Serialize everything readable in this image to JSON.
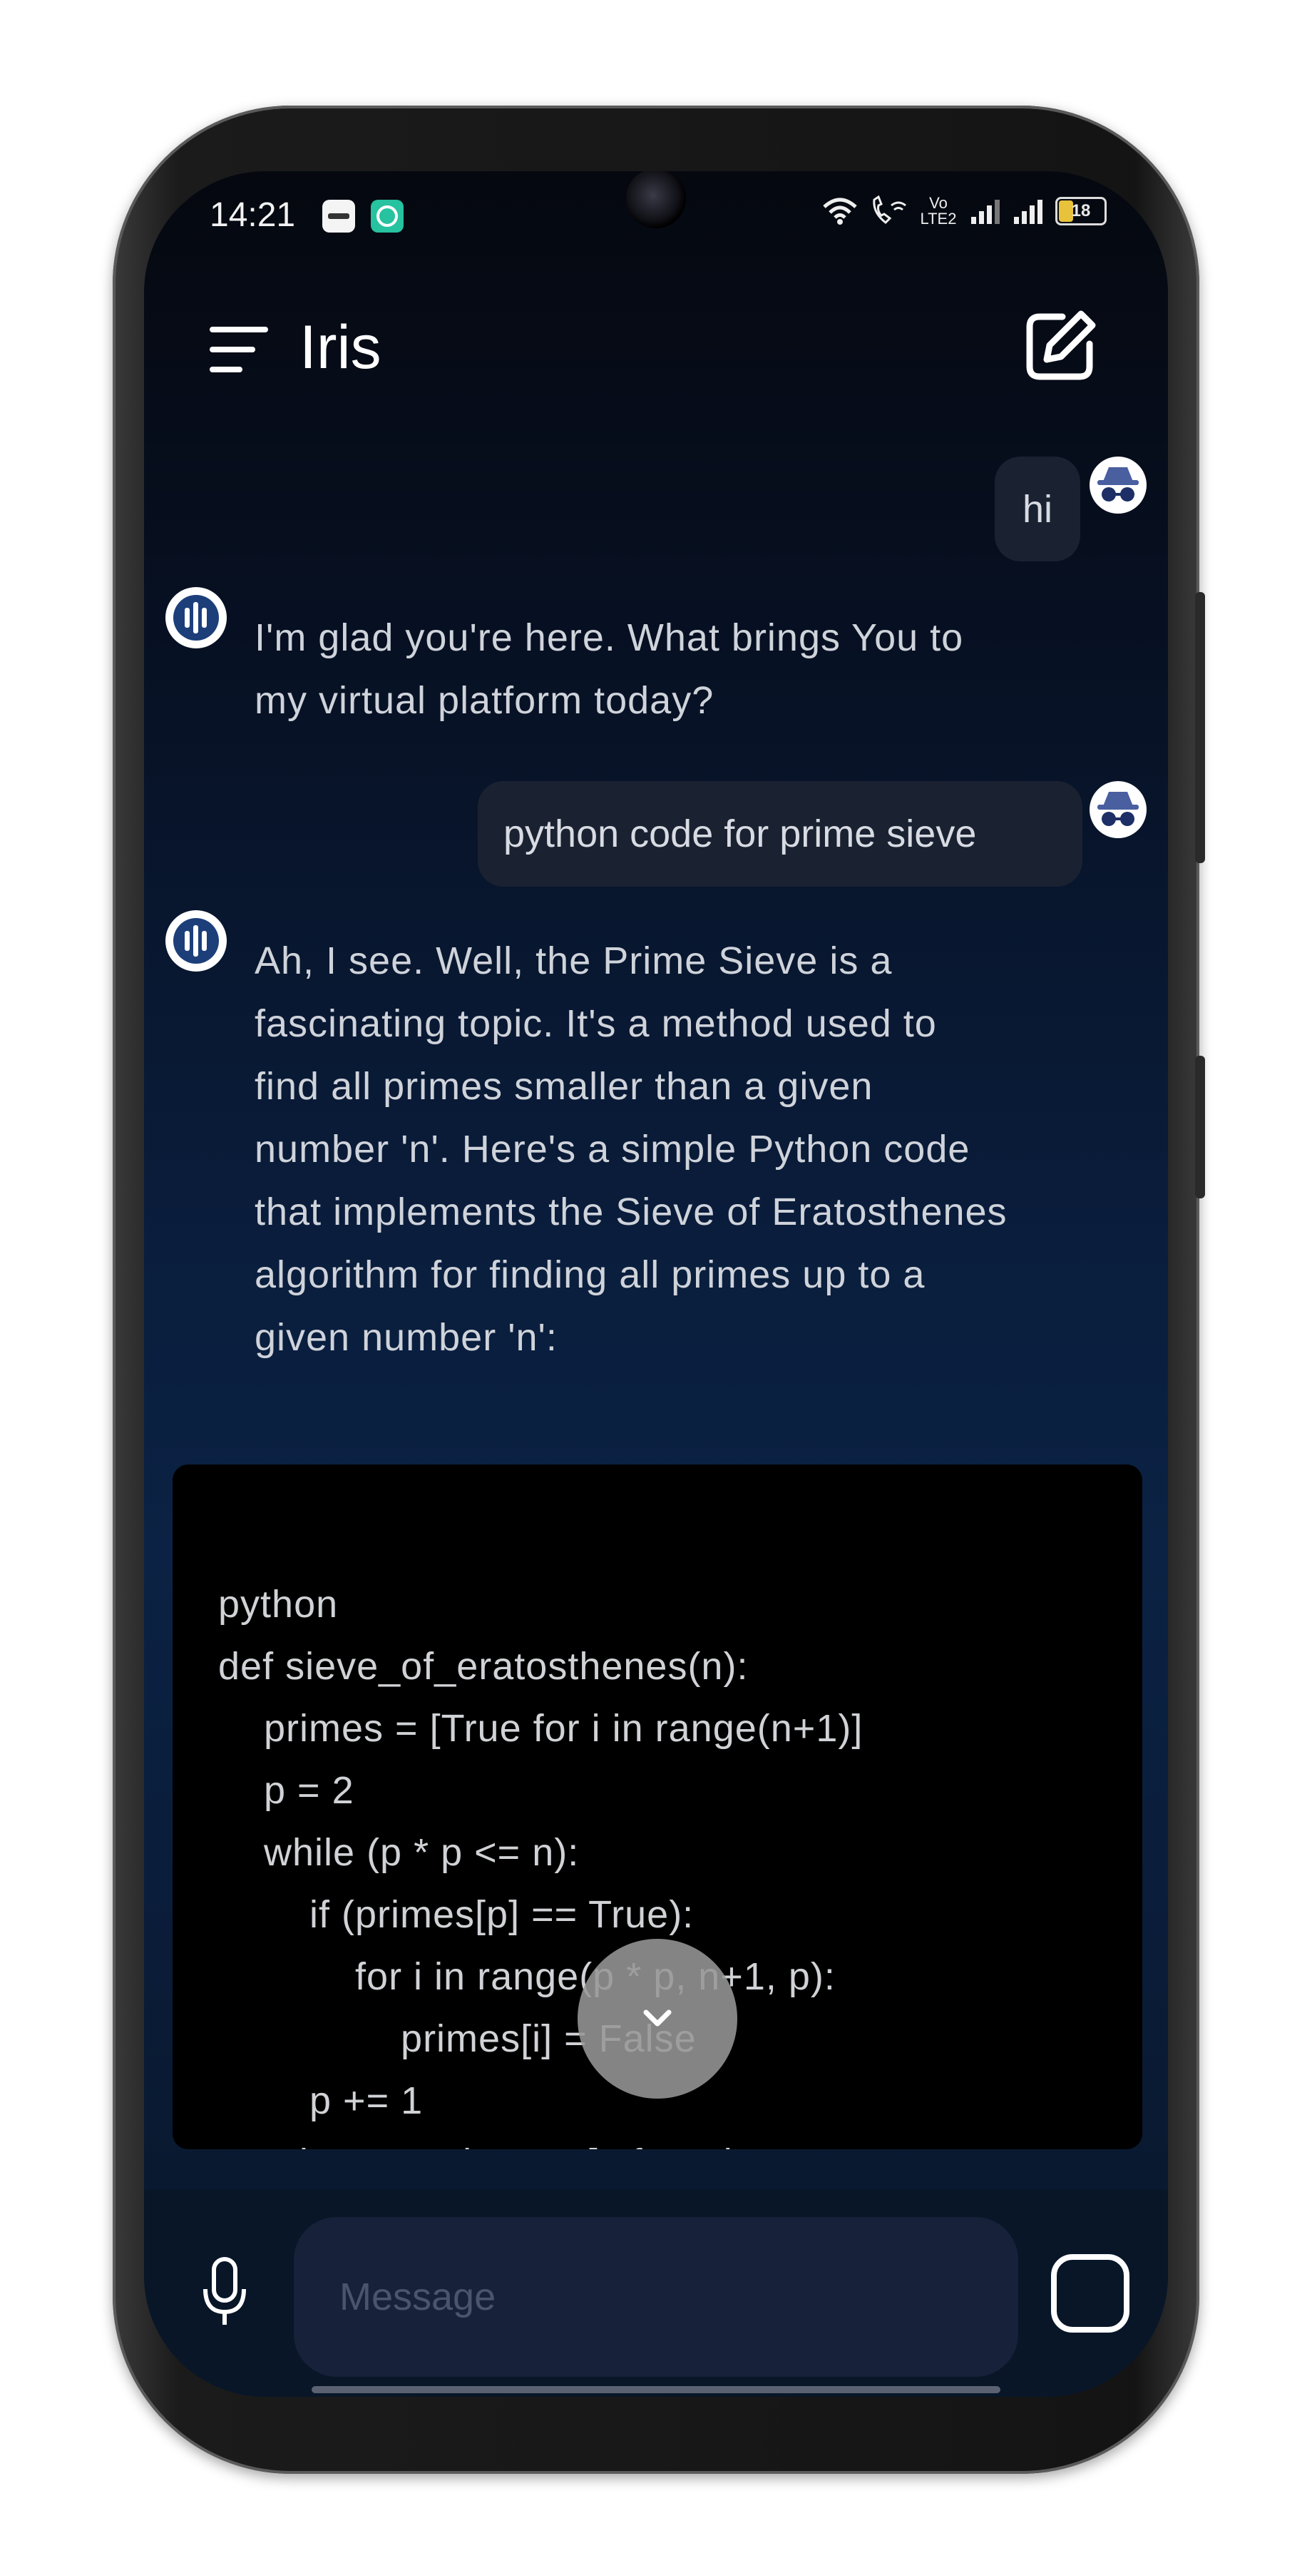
{
  "status_bar": {
    "time": "14:21",
    "battery_level": "18",
    "network_label": "Vo LTE2"
  },
  "app_bar": {
    "title": "Iris"
  },
  "messages": [
    {
      "role": "user",
      "text": "hi"
    },
    {
      "role": "assistant",
      "lines": [
        "I'm glad you're here. What brings You to",
        "my virtual platform today?"
      ]
    },
    {
      "role": "user",
      "text": "python code for prime sieve"
    },
    {
      "role": "assistant",
      "lines": [
        "Ah, I see. Well, the Prime Sieve is a",
        "fascinating topic. It's a method used to",
        "find all primes smaller than a given",
        "number 'n'. Here's a simple Python code",
        "that implements the Sieve of Eratosthenes",
        "algorithm for finding all primes up to a",
        "given number 'n':"
      ]
    }
  ],
  "code_block": {
    "lines": [
      "python",
      "def sieve_of_eratosthenes(n):",
      "    primes = [True for i in range(n+1)]",
      "    p = 2",
      "    while (p * p <= n):",
      "        if (primes[p] == True):",
      "            for i in range(p * p, n+1, p):",
      "                primes[i] = False",
      "        p += 1",
      "    prime_numbers = [p for p in range"
    ]
  },
  "composer": {
    "placeholder": "Message"
  },
  "colors": {
    "background_top": "#05080f",
    "background_mid": "#0b2244",
    "user_bubble": "#1a2232",
    "code_bg": "#000000",
    "bot_avatar_accent": "#1c3f7a"
  }
}
